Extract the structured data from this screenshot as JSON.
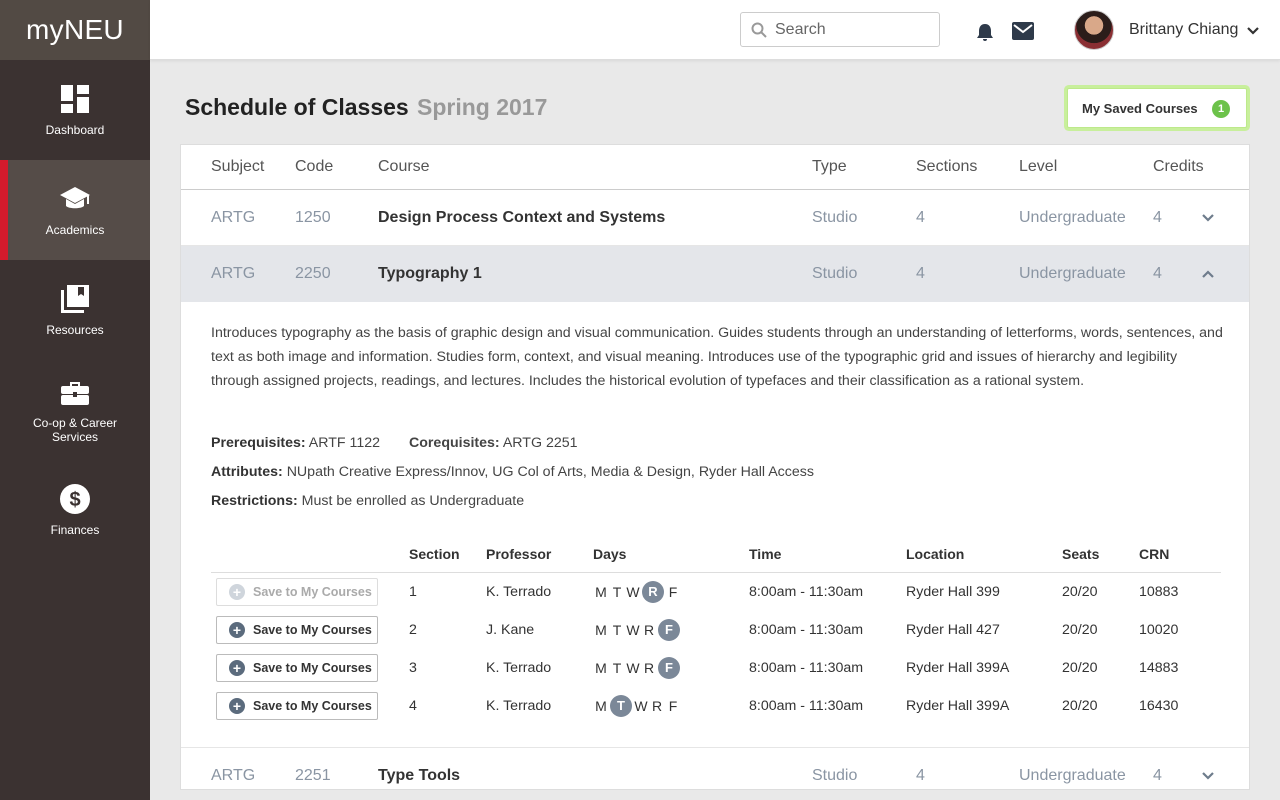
{
  "app": {
    "logo": "myNEU"
  },
  "sidebar": {
    "items": [
      {
        "label": "Dashboard",
        "icon": "dashboard-icon",
        "active": false
      },
      {
        "label": "Academics",
        "icon": "graduation-cap-icon",
        "active": true
      },
      {
        "label": "Resources",
        "icon": "books-icon",
        "active": false
      },
      {
        "label": "Co-op & Career Services",
        "icon": "briefcase-icon",
        "active": false
      },
      {
        "label": "Finances",
        "icon": "dollar-icon",
        "active": false
      }
    ]
  },
  "topbar": {
    "search_placeholder": "Search",
    "user_name": "Brittany Chiang"
  },
  "page": {
    "title": "Schedule of Classes",
    "term": "Spring 2017",
    "saved_label": "My Saved Courses",
    "saved_count": "1"
  },
  "table": {
    "headers": {
      "subject": "Subject",
      "code": "Code",
      "course": "Course",
      "type": "Type",
      "sections": "Sections",
      "level": "Level",
      "credits": "Credits"
    },
    "rows": [
      {
        "subject": "ARTG",
        "code": "1250",
        "course": "Design Process Context and Systems",
        "type": "Studio",
        "sections": "4",
        "level": "Undergraduate",
        "credits": "4",
        "expanded": false
      },
      {
        "subject": "ARTG",
        "code": "2250",
        "course": "Typography 1",
        "type": "Studio",
        "sections": "4",
        "level": "Undergraduate",
        "credits": "4",
        "expanded": true
      },
      {
        "subject": "ARTG",
        "code": "2251",
        "course": "Type Tools",
        "type": "Studio",
        "sections": "4",
        "level": "Undergraduate",
        "credits": "4",
        "expanded": false
      }
    ]
  },
  "detail": {
    "description": "Introduces typography as the basis of graphic design and visual communication. Guides students through an understanding of letterforms, words, sentences, and text as both image and information. Studies form, context, and visual meaning. Introduces use of the typographic grid and issues of hierarchy and legibility through assigned projects, readings, and lectures. Includes the historical evolution of typefaces and their classification as a rational system.",
    "prereq_label": "Prerequisites:",
    "prereq_value": "ARTF 1122",
    "coreq_label": "Corequisites:",
    "coreq_value": "ARTG 2251",
    "attr_label": "Attributes:",
    "attr_value": "NUpath Creative Express/Innov, UG Col of Arts, Media & Design, Ryder Hall Access",
    "restr_label": "Restrictions:",
    "restr_value": "Must be enrolled as Undergraduate"
  },
  "sections": {
    "headers": {
      "section": "Section",
      "professor": "Professor",
      "days": "Days",
      "time": "Time",
      "location": "Location",
      "seats": "Seats",
      "crn": "CRN"
    },
    "save_label": "Save to My Courses",
    "rows": [
      {
        "section": "1",
        "professor": "K. Terrado",
        "days": [
          "M",
          "T",
          "W",
          "R",
          "F"
        ],
        "active_day": "R",
        "time": "8:00am - 11:30am",
        "location": "Ryder Hall 399",
        "seats": "20/20",
        "crn": "10883",
        "saved": true
      },
      {
        "section": "2",
        "professor": "J. Kane",
        "days": [
          "M",
          "T",
          "W",
          "R",
          "F"
        ],
        "active_day": "F",
        "time": "8:00am - 11:30am",
        "location": "Ryder Hall 427",
        "seats": "20/20",
        "crn": "10020",
        "saved": false
      },
      {
        "section": "3",
        "professor": "K. Terrado",
        "days": [
          "M",
          "T",
          "W",
          "R",
          "F"
        ],
        "active_day": "F",
        "time": "8:00am - 11:30am",
        "location": "Ryder Hall 399A",
        "seats": "20/20",
        "crn": "14883",
        "saved": false
      },
      {
        "section": "4",
        "professor": "K. Terrado",
        "days": [
          "M",
          "T",
          "W",
          "R",
          "F"
        ],
        "active_day": "T",
        "time": "8:00am - 11:30am",
        "location": "Ryder Hall 399A",
        "seats": "20/20",
        "crn": "16430",
        "saved": false
      }
    ]
  },
  "colors": {
    "accent_red": "#d41b2c",
    "saved_green": "#6cc24a",
    "sidebar_bg": "#3b3231"
  }
}
